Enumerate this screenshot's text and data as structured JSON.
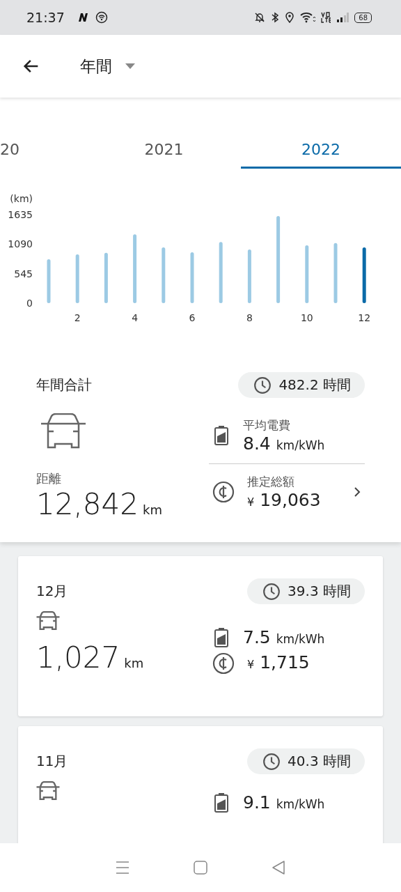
{
  "status_bar": {
    "time": "21:37",
    "battery": "68"
  },
  "header": {
    "title": "年間"
  },
  "year_tabs": [
    {
      "label": "20",
      "selected": false
    },
    {
      "label": "2021",
      "selected": false
    },
    {
      "label": "2022",
      "selected": true
    }
  ],
  "chart": {
    "chart_data": {
      "type": "bar",
      "ylabel": "(km)",
      "x": [
        1,
        2,
        3,
        4,
        5,
        6,
        7,
        8,
        9,
        10,
        11,
        12
      ],
      "series": [
        {
          "color": "#9ccae4",
          "values": [
            810,
            900,
            930,
            1270,
            1030,
            940,
            1130,
            990,
            1610,
            1070,
            1110,
            null
          ]
        },
        {
          "color": "#0a6aa8",
          "values": [
            null,
            null,
            null,
            null,
            null,
            null,
            null,
            null,
            null,
            null,
            null,
            1030
          ]
        }
      ],
      "stacked": true,
      "xlim": [
        1,
        12
      ],
      "ylim": [
        0,
        1635
      ],
      "yticks": [
        0,
        545,
        1090,
        1635
      ],
      "xticks": [
        2,
        4,
        6,
        8,
        10,
        12
      ]
    }
  },
  "summary": {
    "title": "年間合計",
    "hours": "482.2 時間",
    "distance_label": "距離",
    "distance": "12,842",
    "distance_unit": "km",
    "efficiency_label": "平均電費",
    "efficiency": "8.4",
    "efficiency_unit": "km/kWh",
    "cost_label": "推定総額",
    "currency": "¥",
    "cost": "19,063"
  },
  "months": [
    {
      "label": "12月",
      "hours": "39.3 時間",
      "efficiency": "7.5",
      "efficiency_unit": "km/kWh",
      "currency": "¥",
      "cost": "1,715",
      "distance": "1,027",
      "distance_unit": "km"
    },
    {
      "label": "11月",
      "hours": "40.3 時間",
      "efficiency": "9.1",
      "efficiency_unit": "km/kWh"
    }
  ]
}
